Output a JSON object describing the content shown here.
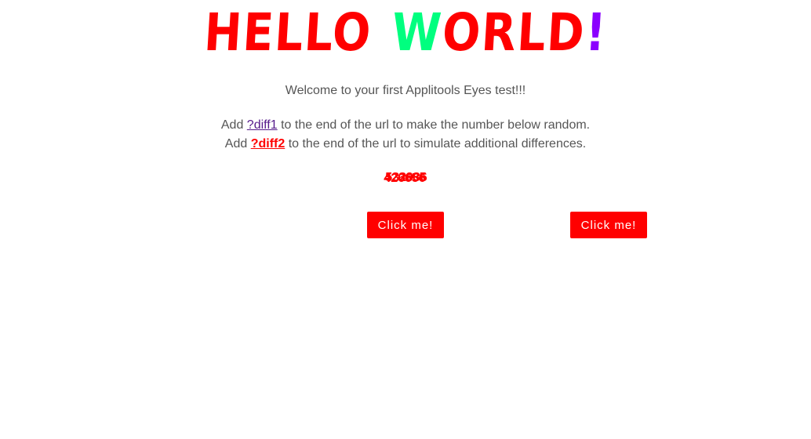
{
  "title": {
    "word1": "HELLO",
    "word2_first": "W",
    "word2_rest": "ORLD",
    "exclamation": "!"
  },
  "colors": {
    "title_red": "#ff0000",
    "title_green": "#00ff7f",
    "title_purple": "#8b00ff",
    "button_bg": "#ff0000",
    "text_gray": "#555555",
    "link1": "#551a8b",
    "link2": "#ff0000"
  },
  "welcome": "Welcome to your first Applitools Eyes test!!!",
  "instructions": [
    {
      "prefix": "Add ",
      "link": "?diff1",
      "suffix": " to the end of the url to make the number below random."
    },
    {
      "prefix": "Add ",
      "link": "?diff2",
      "suffix": " to the end of the url to simulate additional differences."
    }
  ],
  "random_number": {
    "overlapping_values": [
      "423685",
      "532036",
      "426656"
    ]
  },
  "buttons": [
    {
      "label": "Click me!"
    },
    {
      "label": "Click me!"
    }
  ]
}
